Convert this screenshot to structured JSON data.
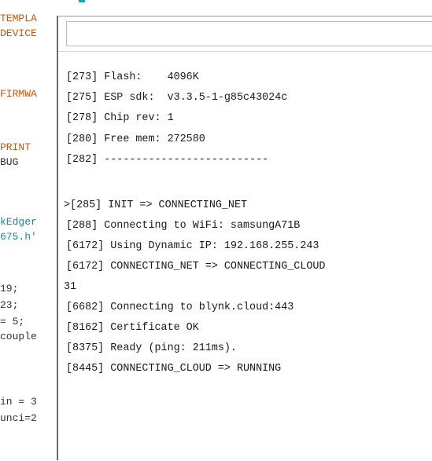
{
  "editor": {
    "lines": [
      {
        "text": "TEMPLA",
        "cls": "kw"
      },
      {
        "text": "DEVICE",
        "cls": "kw"
      },
      {
        "text": "FIRMWA",
        "cls": "kw"
      },
      {
        "text": "PRINT",
        "cls": "kw"
      },
      {
        "text": "BUG",
        "cls": "plain"
      },
      {
        "text": "kEdger",
        "cls": "teal"
      },
      {
        "text": "675.h'",
        "cls": "teal"
      },
      {
        "text": " 19;",
        "cls": "plain"
      },
      {
        "text": " 23;",
        "cls": "plain"
      },
      {
        "text": "= 5;",
        "cls": "plain"
      },
      {
        "text": "couple",
        "cls": "plain"
      },
      {
        "text": "in = 3",
        "cls": "plain"
      },
      {
        "text": "unci=2",
        "cls": "plain"
      }
    ]
  },
  "serial_monitor": {
    "input_value": "",
    "output_lines": [
      "[273] Flash:    4096K",
      "[275] ESP sdk:  v3.3.5-1-g85c43024c",
      "[278] Chip rev: 1",
      "[280] Free mem: 272580",
      "[282] --------------------------",
      "",
      ">[285] INIT => CONNECTING_NET",
      "[288] Connecting to WiFi: samsungA71B",
      "[6172] Using Dynamic IP: 192.168.255.243",
      "[6172] CONNECTING_NET => CONNECTING_CLOUD",
      "31",
      "[6682] Connecting to blynk.cloud:443",
      "[8162] Certificate OK",
      "[8375] Ready (ping: 211ms).",
      "[8445] CONNECTING_CLOUD => RUNNING"
    ]
  }
}
